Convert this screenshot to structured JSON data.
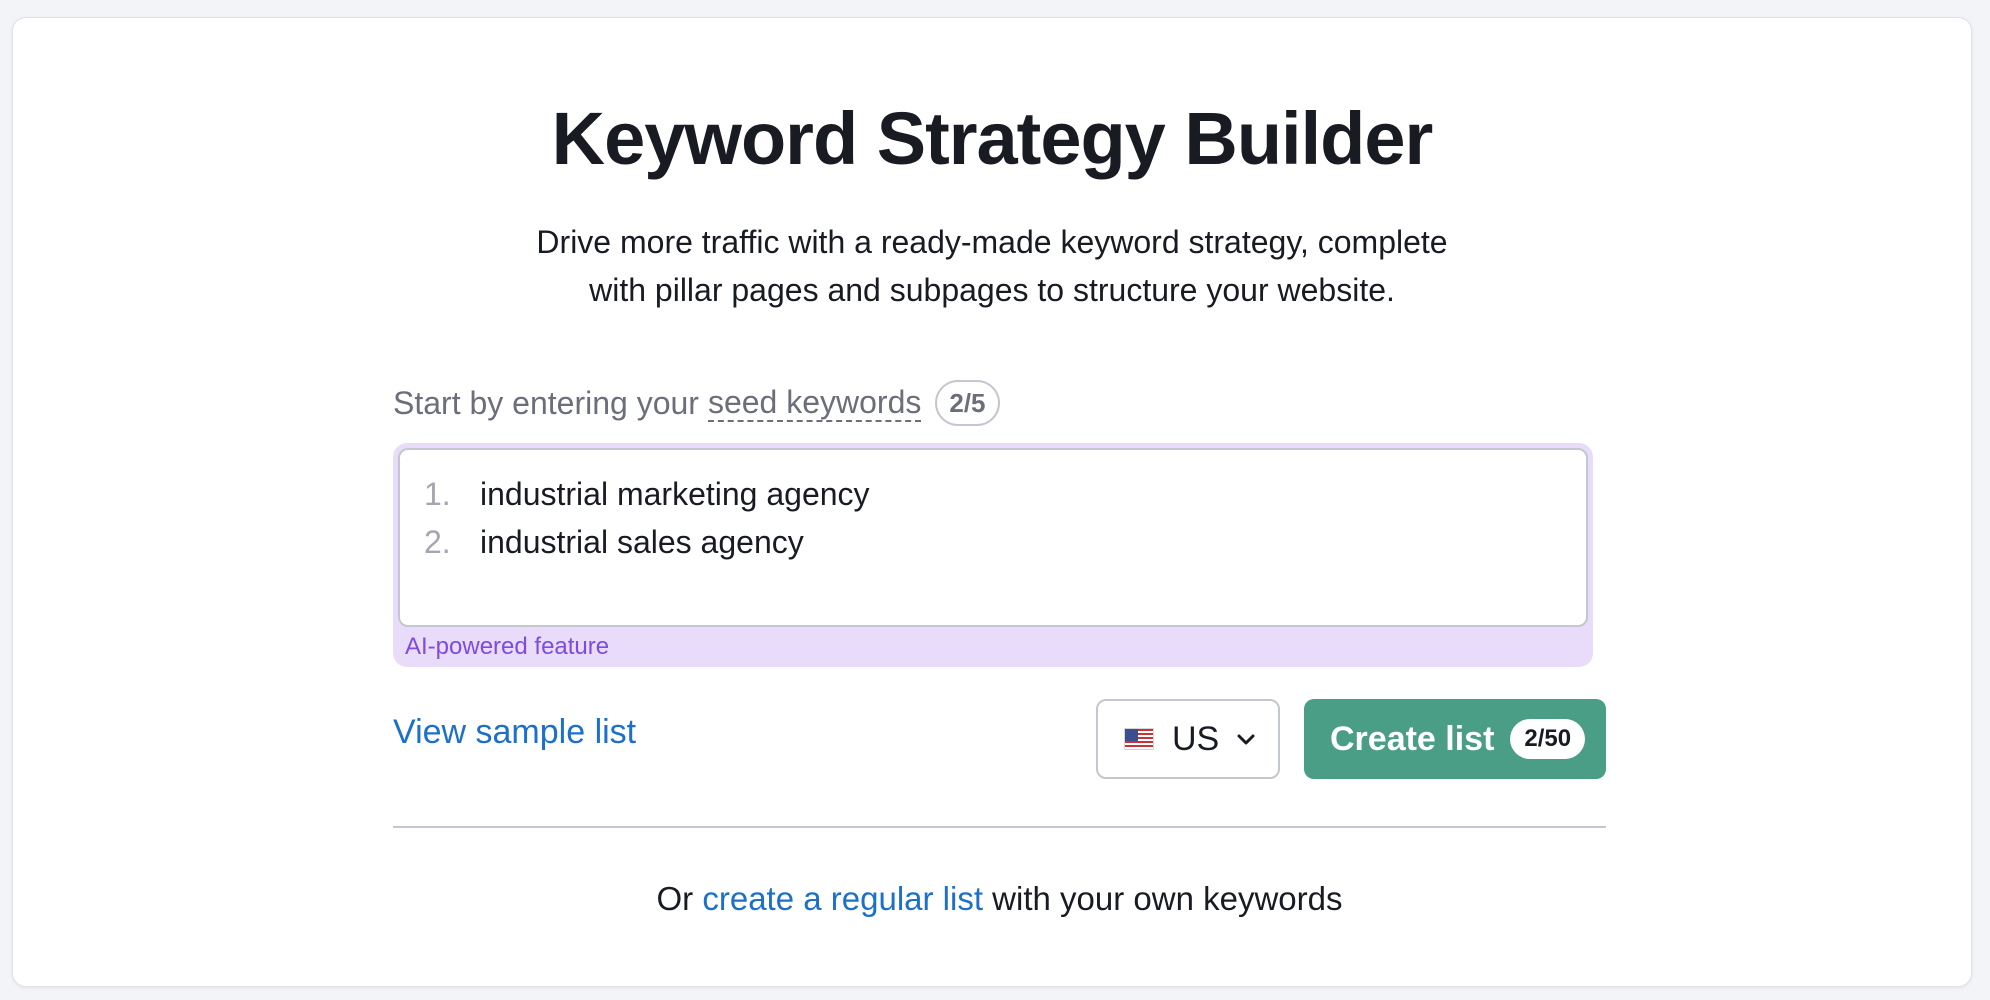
{
  "header": {
    "title": "Keyword Strategy Builder",
    "subtitle_line1": "Drive more traffic with a ready-made keyword strategy, complete",
    "subtitle_line2": "with pillar pages and subpages to structure your website."
  },
  "seed": {
    "label_prefix": "Start by entering your",
    "label_link": "seed keywords",
    "counter": "2/5",
    "keywords": [
      {
        "num": "1.",
        "text": "industrial marketing agency"
      },
      {
        "num": "2.",
        "text": "industrial sales agency"
      }
    ],
    "ai_label": "AI-powered feature"
  },
  "actions": {
    "sample_link": "View sample list",
    "database": "US",
    "database_icon": "us-flag-icon",
    "create_label": "Create list",
    "create_counter": "2/50"
  },
  "footer": {
    "prefix": "Or",
    "link": "create a regular list",
    "suffix": "with your own keywords"
  },
  "colors": {
    "primary_button": "#4a9e85",
    "link": "#1d70c9",
    "ai_background": "#e9dcfb",
    "ai_text": "#7f4ae0"
  }
}
